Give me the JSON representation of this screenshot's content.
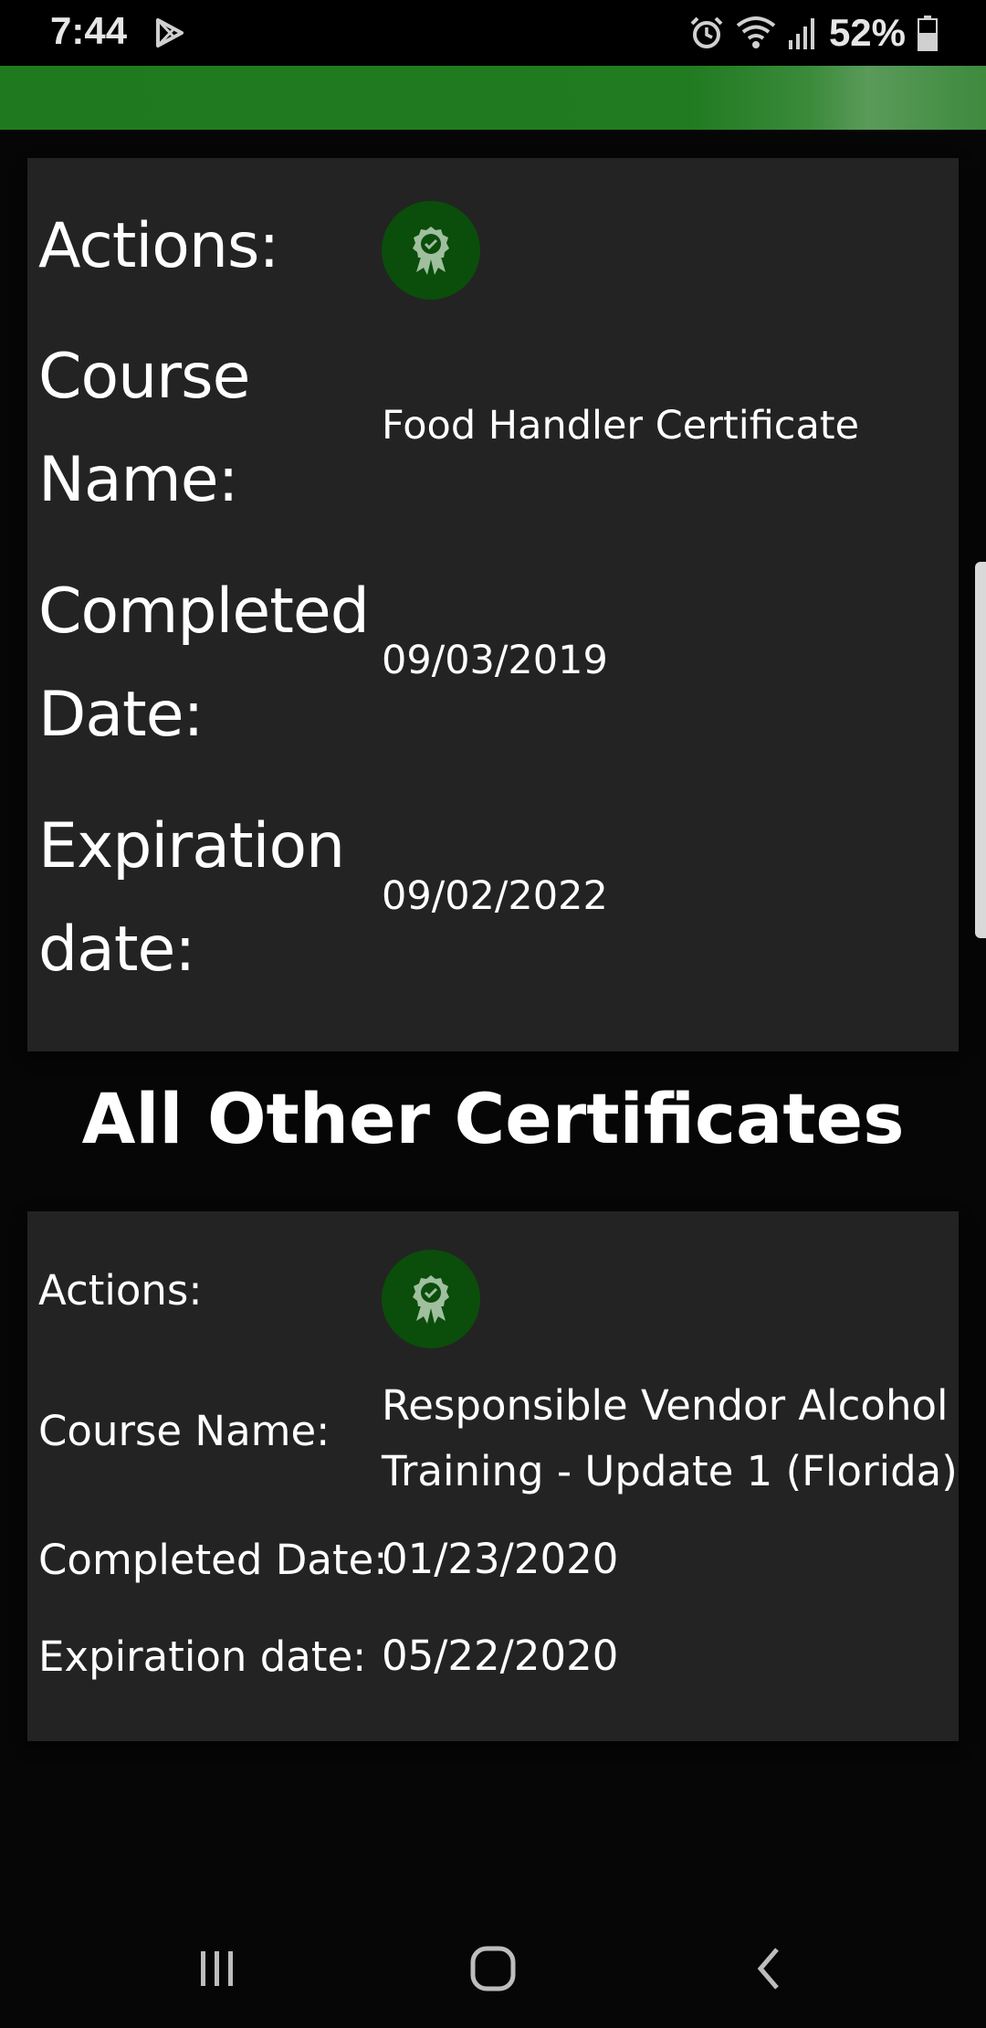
{
  "status_bar": {
    "time": "7:44",
    "battery": "52%",
    "icons": [
      "play-store-icon",
      "alarm-icon",
      "wifi-icon",
      "signal-icon",
      "battery-icon"
    ]
  },
  "colors": {
    "toolbar": "#217b21",
    "card_bg": "#232323",
    "badge_bg": "#0b4d0b",
    "page_bg": "#060606"
  },
  "main_certificate": {
    "actions_label": "Actions:",
    "action_icon": "certificate-badge-icon",
    "course_label_1": "Course",
    "course_label_2": "Name:",
    "course_name": "Food Handler Certificate",
    "completed_label_1": "Completed",
    "completed_label_2": "Date:",
    "completed_date": "09/03/2019",
    "expiration_label_1": "Expiration",
    "expiration_label_2": "date:",
    "expiration_date": "09/02/2022"
  },
  "section_heading": "All Other Certificates",
  "other_certificate": {
    "actions_label": "Actions:",
    "action_icon": "certificate-badge-icon",
    "course_label": "Course Name:",
    "course_name_line1": "Responsible Vendor Alcohol",
    "course_name_line2": "Training - Update 1 (Florida)",
    "completed_label": "Completed Date:",
    "completed_date": "01/23/2020",
    "expiration_label": "Expiration date:",
    "expiration_date": "05/22/2020"
  },
  "nav_bar": {
    "icons": [
      "recent-apps-icon",
      "home-icon",
      "back-icon"
    ]
  }
}
